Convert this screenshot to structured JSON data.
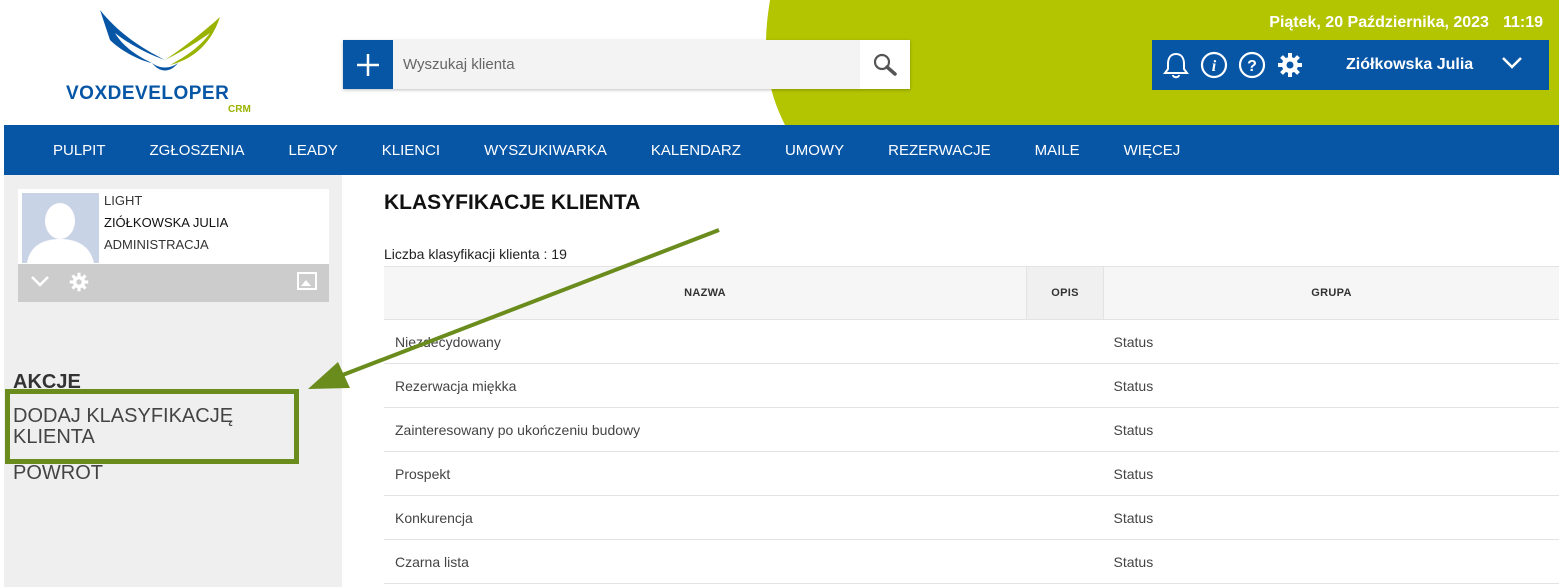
{
  "header": {
    "date": "Piątek, 20 Października, 2023",
    "time": "11:19",
    "logo_text": "VOXDEVELOPER",
    "logo_sub": "CRM",
    "search": {
      "placeholder": "Wyszukaj klienta",
      "value": ""
    },
    "user_name": "Ziółkowska Julia",
    "icons": [
      "plus-icon",
      "search-icon",
      "bell-icon",
      "info-icon",
      "help-icon",
      "gear-icon",
      "chevron-down-icon"
    ]
  },
  "nav": {
    "items": [
      "PULPIT",
      "ZGŁOSZENIA",
      "LEADY",
      "KLIENCI",
      "WYSZUKIWARKA",
      "KALENDARZ",
      "UMOWY",
      "REZERWACJE",
      "MAILE",
      "WIĘCEJ"
    ]
  },
  "sidebar": {
    "profile": {
      "plan": "LIGHT",
      "name": "ZIÓŁKOWSKA JULIA",
      "role": "ADMINISTRACJA"
    },
    "section_title": "AKCJE",
    "actions": [
      "DODAJ KLASYFIKACJĘ KLIENTA",
      "POWRÓT"
    ]
  },
  "main": {
    "title": "KLASYFIKACJE KLIENTA",
    "count_label": "Liczba klasyfikacji klienta : 19",
    "table": {
      "columns": [
        "NAZWA",
        "OPIS",
        "GRUPA"
      ],
      "rows": [
        {
          "name": "Niezdecydowany",
          "opis": "",
          "group": "Status"
        },
        {
          "name": "Rezerwacja miękka",
          "opis": "",
          "group": "Status"
        },
        {
          "name": "Zainteresowany po ukończeniu budowy",
          "opis": "",
          "group": "Status"
        },
        {
          "name": "Prospekt",
          "opis": "",
          "group": "Status"
        },
        {
          "name": "Konkurencja",
          "opis": "",
          "group": "Status"
        },
        {
          "name": "Czarna lista",
          "opis": "",
          "group": "Status"
        }
      ]
    }
  },
  "colors": {
    "brand_blue": "#0756a6",
    "accent_green": "#b3c400",
    "highlight_green": "#6a8c1c"
  }
}
